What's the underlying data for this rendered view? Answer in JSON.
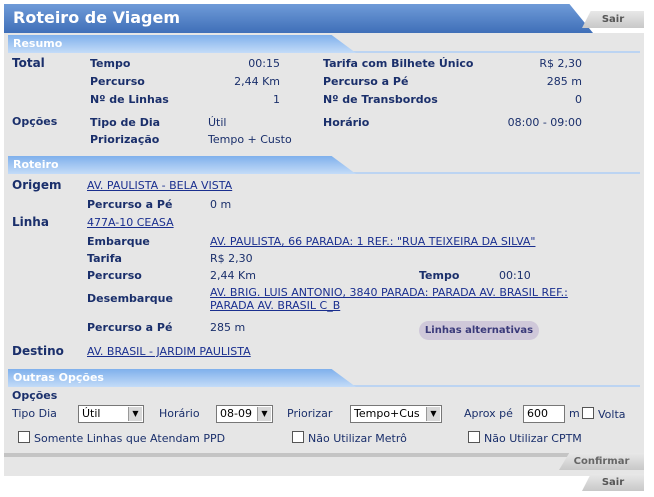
{
  "header": {
    "title": "Roteiro de Viagem",
    "exit_label": "Sair"
  },
  "resumo": {
    "section_title": "Resumo",
    "total_label": "Total",
    "tempo_label": "Tempo",
    "tempo_value": "00:15",
    "percurso_label": "Percurso",
    "percurso_value": "2,44 Km",
    "linhas_label": "Nº de Linhas",
    "linhas_value": "1",
    "tarifa_label": "Tarifa com Bilhete Único",
    "tarifa_value": "R$ 2,30",
    "percurso_pe_label": "Percurso a Pé",
    "percurso_pe_value": "285 m",
    "transbordos_label": "Nº de Transbordos",
    "transbordos_value": "0",
    "opcoes_label": "Opções",
    "tipo_dia_label": "Tipo de Dia",
    "tipo_dia_value": "Útil",
    "priorizacao_label": "Priorização",
    "priorizacao_value": "Tempo + Custo",
    "horario_label": "Horário",
    "horario_value": "08:00 - 09:00"
  },
  "roteiro": {
    "section_title": "Roteiro",
    "origem_label": "Origem",
    "origem_value": "AV. PAULISTA - BELA VISTA",
    "origem_pe_label": "Percurso a Pé",
    "origem_pe_value": "0 m",
    "linha_label": "Linha",
    "linha_value": "477A-10 CEASA",
    "embarque_label": "Embarque",
    "embarque_value": "AV. PAULISTA, 66 PARADA: 1 REF.: \"RUA TEIXEIRA DA SILVA\"",
    "tarifa_label": "Tarifa",
    "tarifa_value": "R$ 2,30",
    "percurso_label": "Percurso",
    "percurso_value": "2,44 Km",
    "tempo_label": "Tempo",
    "tempo_value": "00:10",
    "desembarque_label": "Desembarque",
    "desembarque_line1": "AV. BRIG. LUIS ANTONIO, 3840 PARADA: PARADA AV. BRASIL REF.:",
    "desembarque_line2": "PARADA AV. BRASIL C_B",
    "destino_pe_label": "Percurso a Pé",
    "destino_pe_value": "285 m",
    "alt_button": "Linhas alternativas",
    "destino_label": "Destino",
    "destino_value": "AV. BRASIL - JARDIM PAULISTA"
  },
  "outras": {
    "section_title": "Outras Opções",
    "opcoes_label": "Opções",
    "tipo_dia_label": "Tipo Dia",
    "tipo_dia_value": "Útil",
    "horario_label": "Horário",
    "horario_value": "08-09",
    "priorizar_label": "Priorizar",
    "priorizar_value": "Tempo+Cus",
    "aprox_label": "Aprox pé",
    "aprox_value": "600",
    "aprox_unit": "m",
    "volta_label": "Volta",
    "ppd_label": "Somente Linhas que Atendam PPD",
    "metro_label": "Não Utilizar Metrô",
    "cptm_label": "Não Utilizar CPTM",
    "confirm_label": "Confirmar"
  },
  "footer": {
    "exit_label": "Sair"
  }
}
